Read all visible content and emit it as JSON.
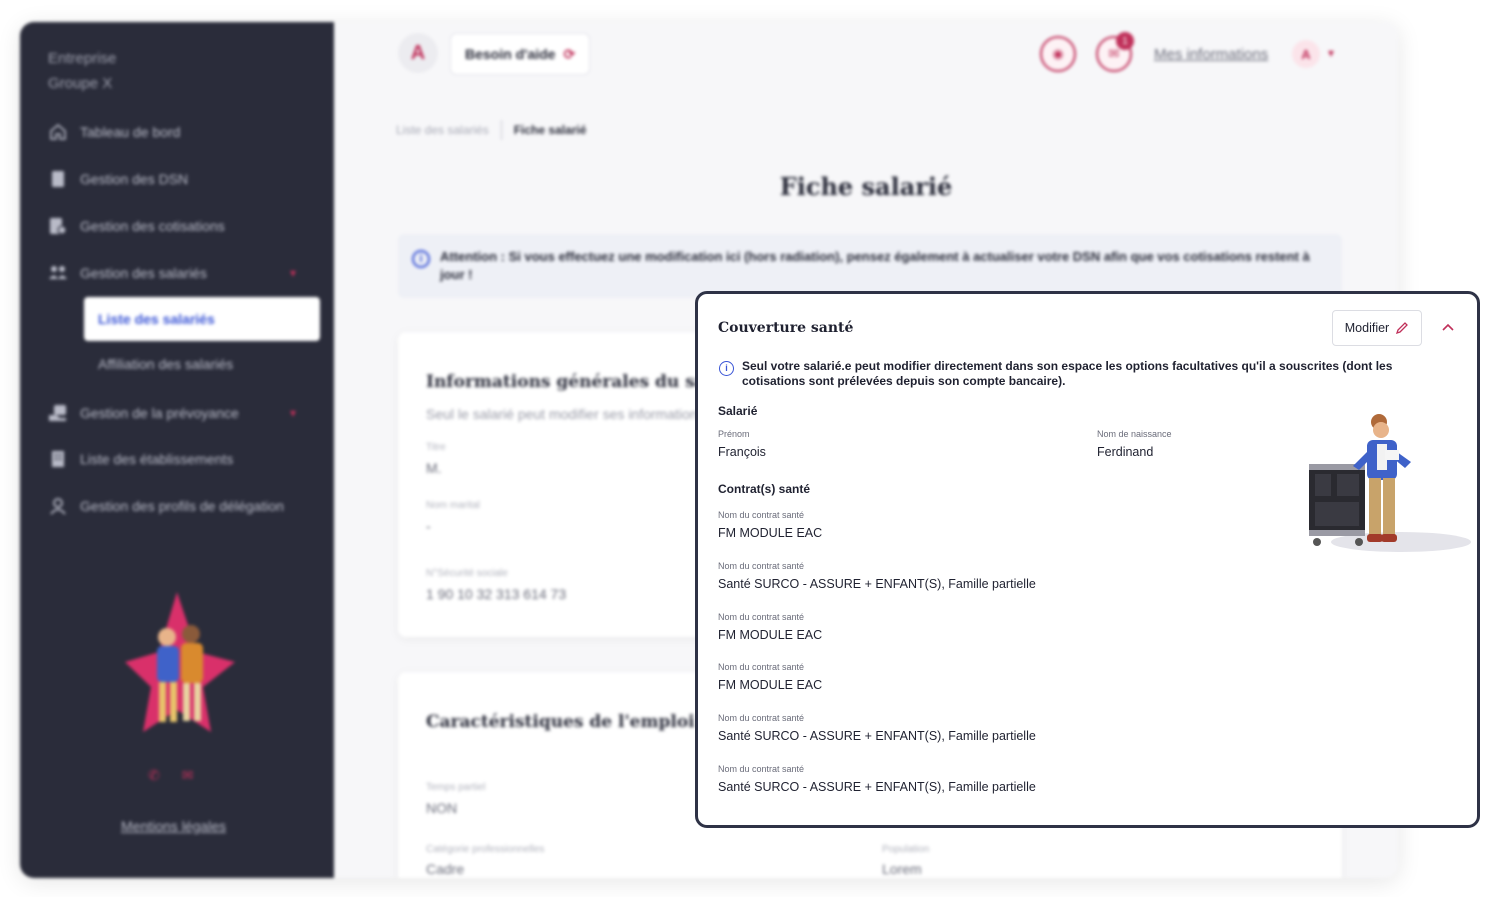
{
  "sidebar": {
    "company_line1": "Entreprise",
    "company_line2": "Groupe X",
    "items": [
      {
        "label": "Tableau de bord",
        "icon": "home-icon"
      },
      {
        "label": "Gestion des DSN",
        "icon": "document-icon"
      },
      {
        "label": "Gestion des cotisations",
        "icon": "document-euro-icon"
      },
      {
        "label": "Gestion des salariés",
        "icon": "people-icon"
      },
      {
        "label": "Gestion de la prévoyance",
        "icon": "hand-shield-icon"
      },
      {
        "label": "Liste des établissements",
        "icon": "building-icon"
      },
      {
        "label": "Gestion des profils de délégation",
        "icon": "user-icon"
      }
    ],
    "active_item": "Liste des salariés",
    "sub_item": "Affiliation des salariés",
    "legal": "Mentions légales"
  },
  "topbar": {
    "logo": "A",
    "help": "Besoin d'aide",
    "badge": "1",
    "my_info": "Mes informations"
  },
  "breadcrumb": {
    "parent": "Liste des salariés",
    "current": "Fiche salarié"
  },
  "page_title": "Fiche salarié",
  "alert": "Attention : Si vous effectuez une modification ici (hors radiation), pensez également à actualiser votre DSN afin que vos cotisations restent à jour !",
  "general_card": {
    "title": "Informations générales du salarié",
    "subtitle": "Seul le salarié peut modifier ses informations",
    "fields": [
      {
        "label": "Titre",
        "value": "M."
      },
      {
        "label": "Nom marital",
        "value": "-"
      },
      {
        "label": "N°Sécurité sociale",
        "value": "1 90 10 32 313 614 73"
      }
    ]
  },
  "job_card": {
    "title": "Caractéristiques de l'emploi du salarié",
    "fields": [
      {
        "label": "Temps partiel",
        "value": "NON"
      },
      {
        "label": "Catégorie professionnelles",
        "value": "Cadre"
      },
      {
        "label": "Population",
        "value": "Lorem"
      }
    ]
  },
  "panel": {
    "title": "Couverture santé",
    "edit_label": "Modifier",
    "info": "Seul votre salarié.e peut modifier directement dans son espace les options facultatives qu'il a souscrites (dont les cotisations sont prélevées depuis son compte bancaire).",
    "employee_section": "Salarié",
    "first_name_label": "Prénom",
    "first_name": "François",
    "birth_name_label": "Nom de naissance",
    "birth_name": "Ferdinand",
    "contracts_section": "Contrat(s) santé",
    "contracts": [
      {
        "label": "Nom du contrat santé",
        "value": "FM MODULE EAC"
      },
      {
        "label": "Nom du contrat santé",
        "value": "Santé SURCO - ASSURE + ENFANT(S), Famille partielle"
      },
      {
        "label": "Nom du contrat santé",
        "value": "FM MODULE EAC"
      },
      {
        "label": "Nom du contrat santé",
        "value": "FM MODULE EAC"
      },
      {
        "label": "Nom du contrat santé",
        "value": "Santé SURCO - ASSURE + ENFANT(S), Famille partielle"
      },
      {
        "label": "Nom du contrat santé",
        "value": "Santé SURCO - ASSURE + ENFANT(S), Famille partielle"
      }
    ]
  },
  "colors": {
    "sidebar_bg": "#2a2c3a",
    "accent": "#c0305a",
    "link_blue": "#3a55d6",
    "panel_border": "#2e3246"
  }
}
